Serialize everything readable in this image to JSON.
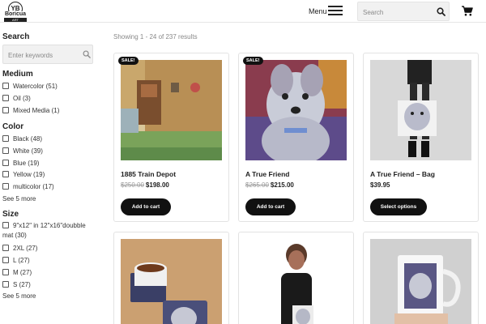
{
  "header": {
    "logo_initials": "YB",
    "logo_word": "Boricua",
    "logo_bar": "ART",
    "menu_label": "Menu",
    "search_placeholder": "Search",
    "icons": [
      "menu-icon",
      "search-icon",
      "cart-icon"
    ]
  },
  "sidebar": {
    "search": {
      "title": "Search",
      "placeholder": "Enter keywords"
    },
    "medium": {
      "title": "Medium",
      "options": [
        "Watercolor (51)",
        "Oil (3)",
        "Mixed Media (1)"
      ]
    },
    "color": {
      "title": "Color",
      "options": [
        "Black (48)",
        "White (39)",
        "Blue (19)",
        "Yellow (19)",
        "multicolor (17)"
      ],
      "see_more": "See 5 more"
    },
    "size": {
      "title": "Size",
      "options": [
        "9\"x12\" in 12\"x16\"doubble mat (30)",
        "2XL (27)",
        "L (27)",
        "M (27)",
        "S (27)"
      ],
      "see_more": "See 5 more"
    }
  },
  "main": {
    "results_text": "Showing 1 - 24 of 237 results",
    "products": [
      {
        "name": "1885 Train Depot",
        "old_price": "$250.00",
        "price": "$198.00",
        "sale_badge": "SALE!",
        "button": "Add to cart"
      },
      {
        "name": "A True Friend",
        "old_price": "$265.00",
        "price": "$215.00",
        "sale_badge": "SALE!",
        "button": "Add to cart"
      },
      {
        "name": "A True Friend – Bag",
        "old_price": "",
        "price": "$39.95",
        "sale_badge": "",
        "button": "Select options"
      },
      {
        "name": "",
        "old_price": "",
        "price": "",
        "sale_badge": "",
        "button": ""
      },
      {
        "name": "",
        "old_price": "",
        "price": "",
        "sale_badge": "",
        "button": ""
      },
      {
        "name": "",
        "old_price": "",
        "price": "",
        "sale_badge": "",
        "button": ""
      }
    ]
  }
}
